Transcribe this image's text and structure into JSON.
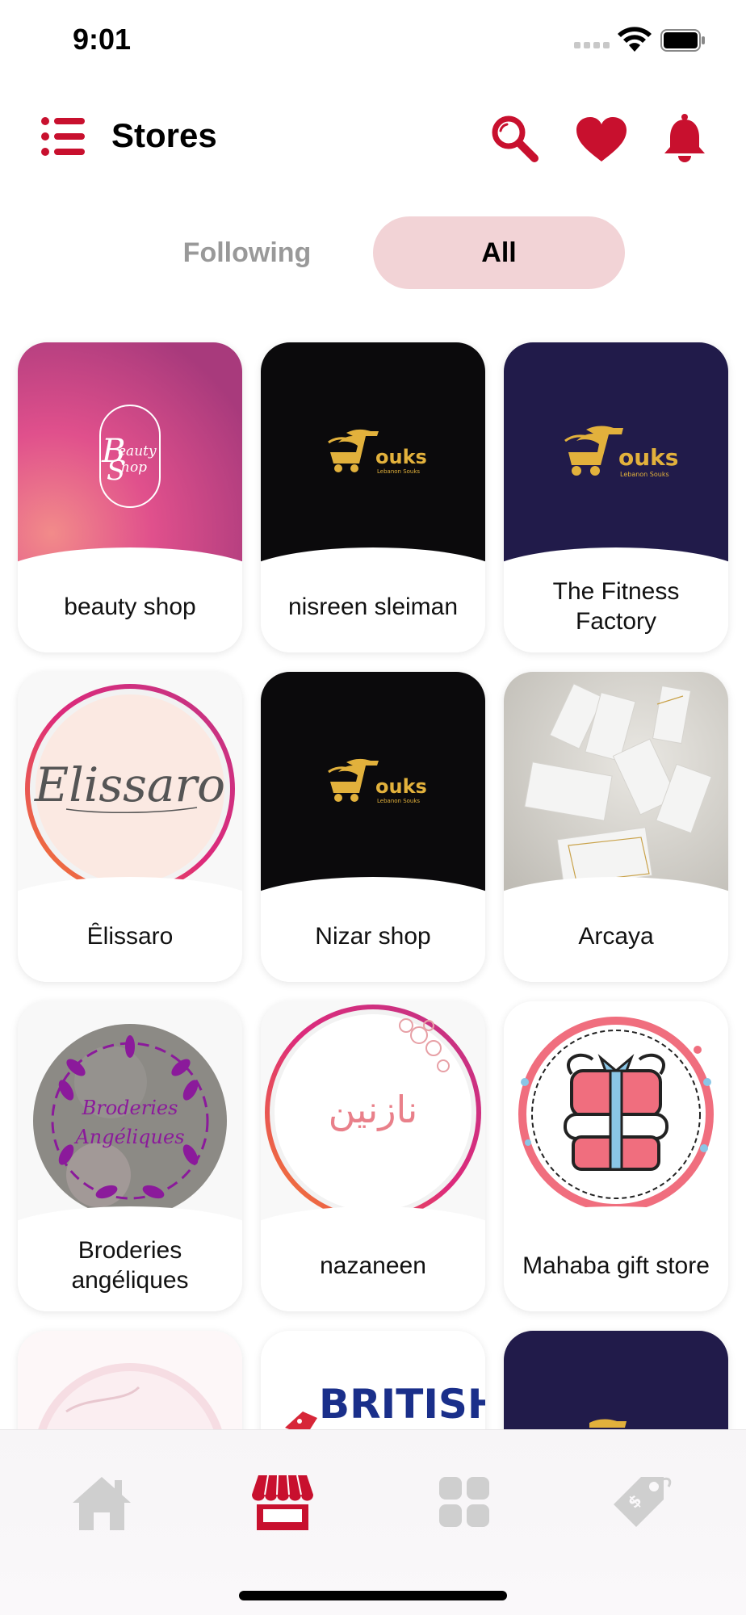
{
  "status_bar": {
    "time": "9:01"
  },
  "header": {
    "title": "Stores"
  },
  "tabs": [
    {
      "label": "Following",
      "selected": false
    },
    {
      "label": "All",
      "selected": true
    }
  ],
  "stores": [
    {
      "name": "beauty shop",
      "logo_text": [
        "eauty",
        "hop"
      ]
    },
    {
      "name": "nisreen sleiman",
      "logo_text": [
        "ouks",
        "Lebanon Souks"
      ]
    },
    {
      "name": "The Fitness Factory",
      "logo_text": [
        "ouks",
        "Lebanon Souks"
      ]
    },
    {
      "name": "Ȇlissaro",
      "logo_text": [
        "Elissaro"
      ]
    },
    {
      "name": "Nizar shop",
      "logo_text": [
        "ouks",
        "Lebanon Souks"
      ]
    },
    {
      "name": "Arcaya",
      "logo_text": []
    },
    {
      "name": "Broderies angéliques",
      "logo_text": [
        "Broderies",
        "Angéliques"
      ]
    },
    {
      "name": "nazaneen",
      "logo_text": [
        "نازنين"
      ]
    },
    {
      "name": "Mahaba gift store",
      "logo_text": []
    },
    {
      "name": "",
      "logo_text": []
    },
    {
      "name": "",
      "logo_text": [
        "BRITISH"
      ]
    },
    {
      "name": "",
      "logo_text": []
    }
  ],
  "bottom_nav": [
    {
      "icon": "home-icon",
      "active": false
    },
    {
      "icon": "store-icon",
      "active": true
    },
    {
      "icon": "grid-icon",
      "active": false
    },
    {
      "icon": "tag-icon",
      "active": false
    }
  ],
  "colors": {
    "accent": "#c8102e",
    "tab_selected_bg": "#f2d3d6",
    "tab_inactive_text": "#999999",
    "nav_inactive": "#cfcfcf",
    "souks_gold": "#e2b13c",
    "navy": "#211b4a"
  }
}
